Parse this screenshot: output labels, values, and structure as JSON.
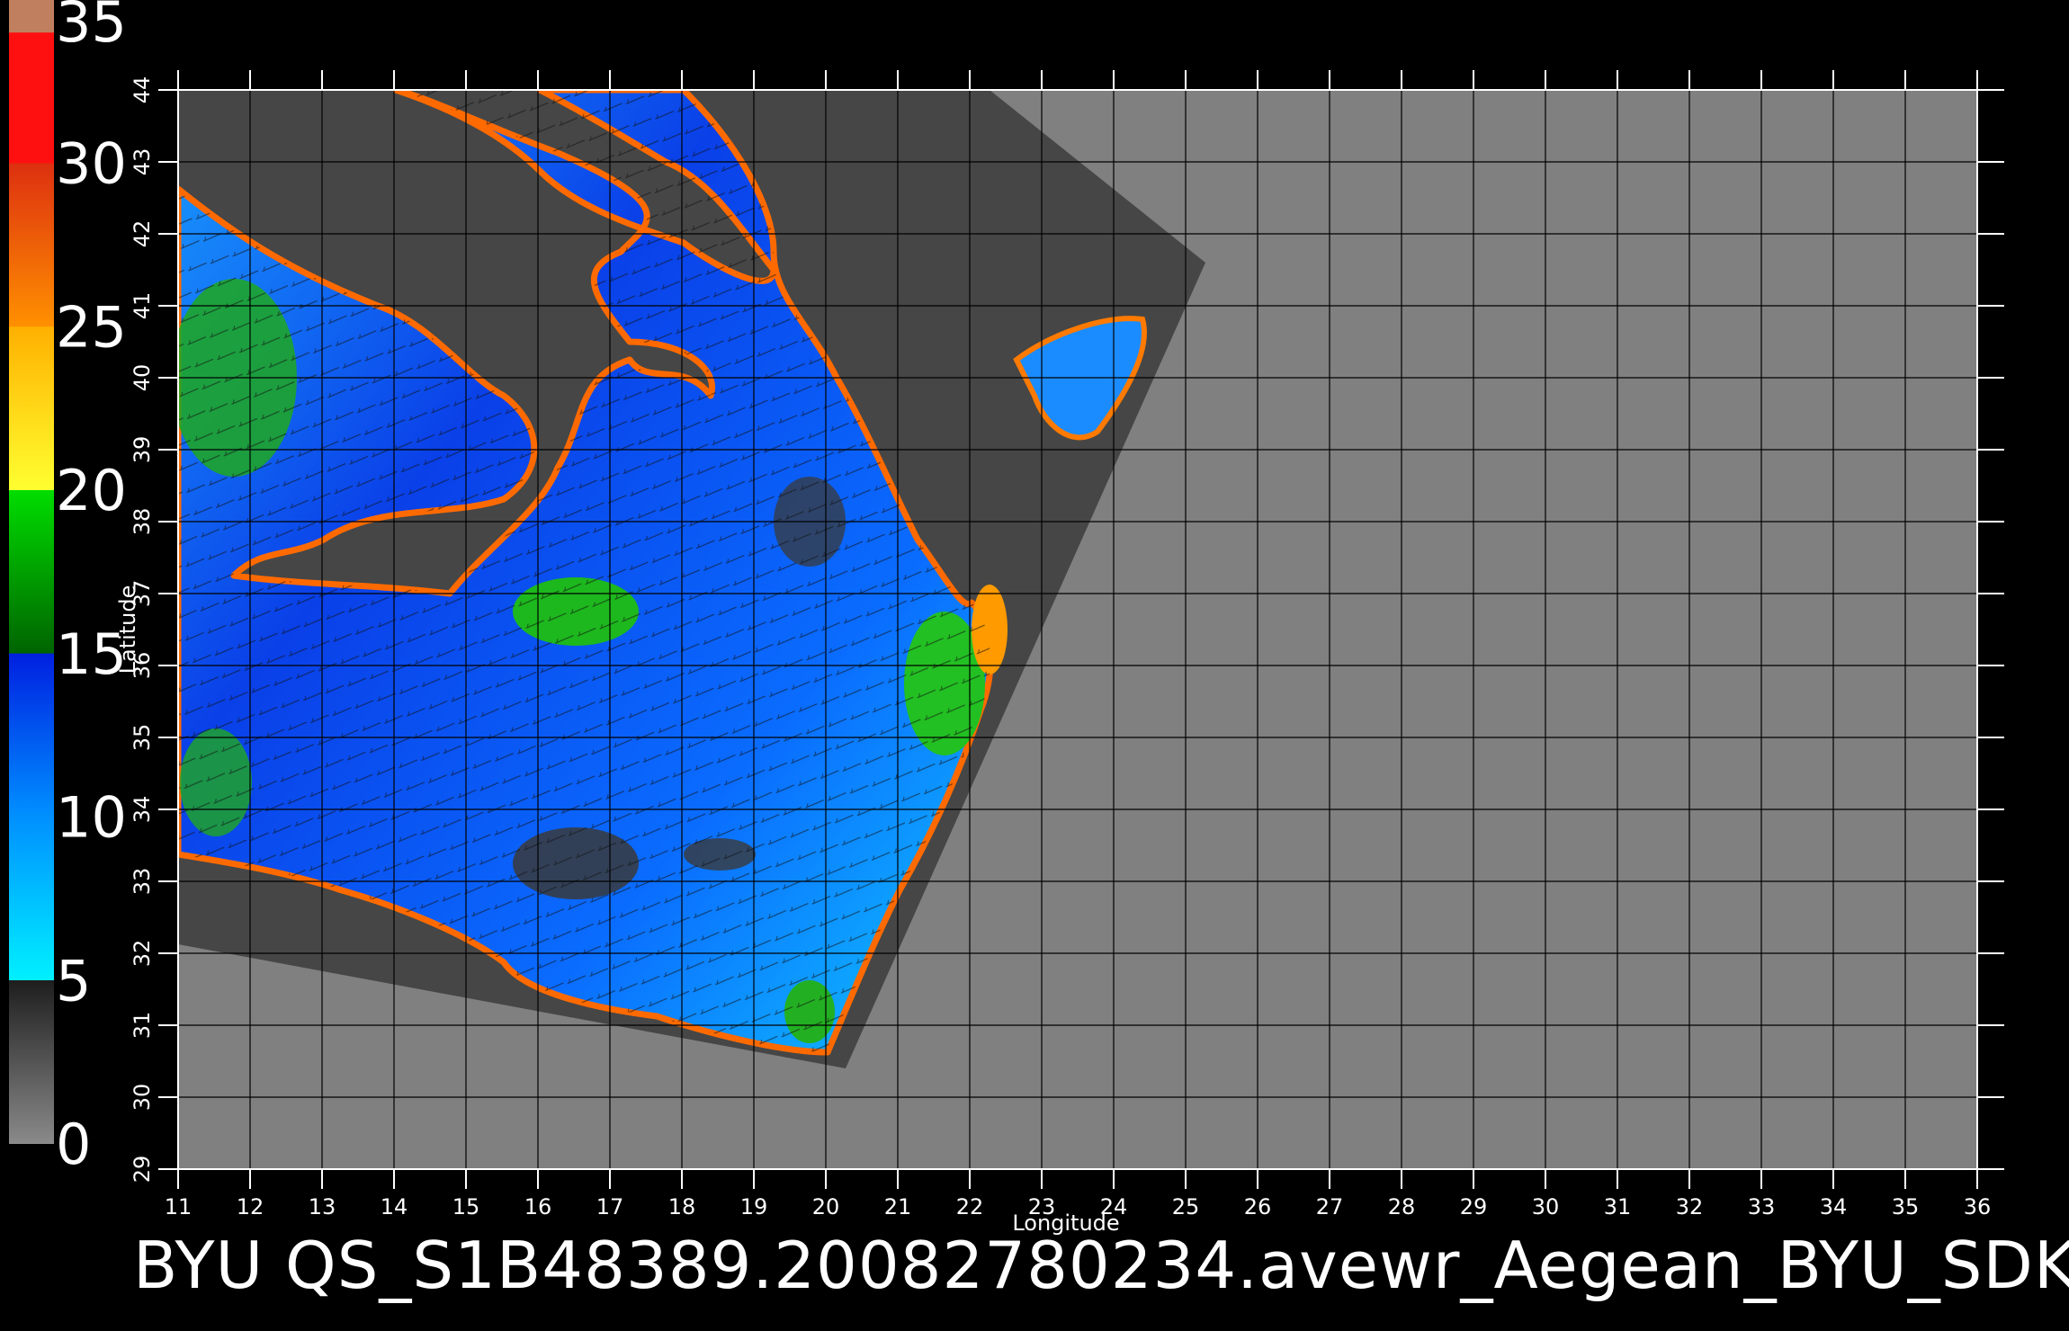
{
  "title": "BYU  QS_S1B48389.20082780234.avewr_Aegean_BYU_SDK",
  "colorbar": {
    "labels": [
      "0",
      "5",
      "10",
      "15",
      "20",
      "25",
      "30",
      "35"
    ],
    "stops": [
      {
        "value": 0,
        "color": "#8a8a8a"
      },
      {
        "value": 5,
        "color": "#1e1e1e"
      },
      {
        "value": 5.01,
        "color": "#00f0ff"
      },
      {
        "value": 10,
        "color": "#0090ff"
      },
      {
        "value": 15,
        "color": "#0020e0"
      },
      {
        "value": 15.01,
        "color": "#006400"
      },
      {
        "value": 20,
        "color": "#00dd00"
      },
      {
        "value": 20.01,
        "color": "#ffff30"
      },
      {
        "value": 25,
        "color": "#ffb000"
      },
      {
        "value": 25.01,
        "color": "#ff9000"
      },
      {
        "value": 30,
        "color": "#dd3010"
      },
      {
        "value": 30.01,
        "color": "#ff1010"
      },
      {
        "value": 34,
        "color": "#ff1010"
      },
      {
        "value": 34.01,
        "color": "#c08060"
      },
      {
        "value": 35,
        "color": "#c08060"
      }
    ]
  },
  "axes": {
    "x_label": "Longitude",
    "y_label": "Latitude",
    "x_ticks": [
      "11",
      "12",
      "13",
      "14",
      "15",
      "16",
      "17",
      "18",
      "19",
      "20",
      "21",
      "22",
      "23",
      "24",
      "25",
      "26",
      "27",
      "28",
      "29",
      "30",
      "31",
      "32",
      "33",
      "34",
      "35",
      "36"
    ],
    "y_ticks": [
      "29",
      "30",
      "31",
      "32",
      "33",
      "34",
      "35",
      "36",
      "37",
      "38",
      "39",
      "40",
      "41",
      "42",
      "43",
      "44"
    ]
  },
  "map_colors": {
    "background": "#808080",
    "swath": "#464646",
    "land": "#505050"
  }
}
